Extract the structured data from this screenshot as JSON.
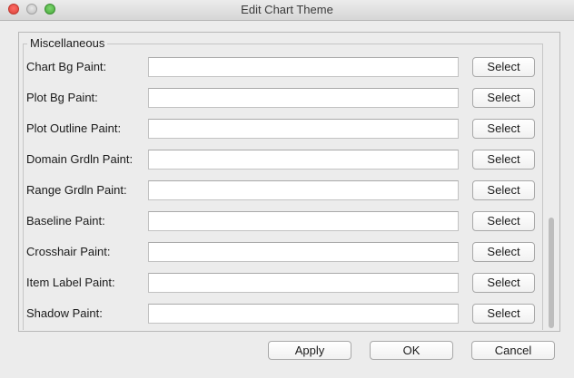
{
  "window": {
    "title": "Edit Chart Theme"
  },
  "group": {
    "legend": "Miscellaneous"
  },
  "rows": [
    {
      "label": "Chart Bg Paint:",
      "value": "",
      "button": "Select"
    },
    {
      "label": "Plot Bg Paint:",
      "value": "",
      "button": "Select"
    },
    {
      "label": "Plot Outline Paint:",
      "value": "",
      "button": "Select"
    },
    {
      "label": "Domain Grdln Paint:",
      "value": "",
      "button": "Select"
    },
    {
      "label": "Range Grdln Paint:",
      "value": "",
      "button": "Select"
    },
    {
      "label": "Baseline Paint:",
      "value": "",
      "button": "Select"
    },
    {
      "label": "Crosshair Paint:",
      "value": "",
      "button": "Select"
    },
    {
      "label": "Item Label Paint:",
      "value": "",
      "button": "Select"
    },
    {
      "label": "Shadow Paint:",
      "value": "",
      "button": "Select"
    }
  ],
  "footer": {
    "apply_label": "Apply",
    "ok_label": "OK",
    "cancel_label": "Cancel"
  },
  "colors": {
    "window_bg": "#ececec",
    "close_button": "#fc605b",
    "minimize_button": "#d0d0d0",
    "zoom_button": "#5fc454"
  }
}
